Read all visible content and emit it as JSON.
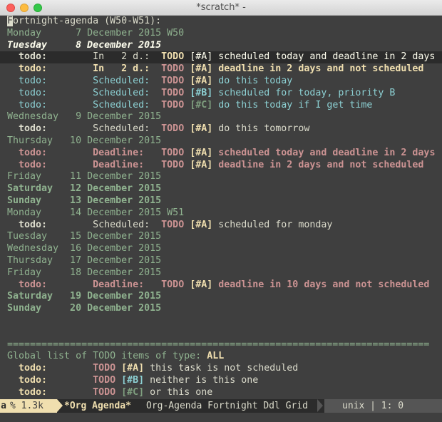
{
  "window": {
    "title": "*scratch* -"
  },
  "agenda": {
    "header": "Fortnight-agenda (W50-W51):",
    "lines": [
      "Monday      7 December 2015 W50",
      "Tuesday     8 December 2015",
      "  todo:        In   2 d.:  TODO [#A] scheduled today and deadline in 2 days",
      "  todo:        In   2 d.:  TODO [#A] deadline in 2 days and not scheduled",
      "  todo:        Scheduled:  TODO [#A] do this today",
      "  todo:        Scheduled:  TODO [#B] scheduled for today, priority B",
      "  todo:        Scheduled:  TODO [#C] do this today if I get time",
      "Wednesday   9 December 2015",
      "  todo:        Scheduled:  TODO [#A] do this tomorrow",
      "Thursday   10 December 2015",
      "  todo:        Deadline:   TODO [#A] scheduled today and deadline in 2 days",
      "  todo:        Deadline:   TODO [#A] deadline in 2 days and not scheduled",
      "Friday     11 December 2015",
      "Saturday   12 December 2015",
      "Sunday     13 December 2015",
      "Monday     14 December 2015 W51",
      "  todo:        Scheduled:  TODO [#A] scheduled for monday",
      "Tuesday    15 December 2015",
      "Wednesday  16 December 2015",
      "Thursday   17 December 2015",
      "Friday     18 December 2015",
      "  todo:        Deadline:   TODO [#A] deadline in 10 days and not scheduled",
      "Saturday   19 December 2015",
      "Sunday     20 December 2015"
    ]
  },
  "global": {
    "separator": "==========================================================================",
    "header_prefix": "Global list of TODO items of type: ",
    "header_type": "ALL",
    "lines": [
      "  todo:        TODO [#A] this task is not scheduled",
      "  todo:        TODO [#B] neither is this one",
      "  todo:        TODO [#C] or this one"
    ]
  },
  "modeline": {
    "indicator": "a",
    "size": "% 1.3k",
    "buffer_name": "*Org Agenda*",
    "modes": "Org-Agenda Fortnight Ddl Grid",
    "encoding": "unix | 1: 0"
  },
  "colors": {
    "background": "#3f3f3f",
    "foreground": "#dcdccc",
    "day_green": "#8fb28f",
    "todo_yellow": "#f0dfaf",
    "scheduled_blue": "#8cd0d3",
    "deadline_red": "#cc9393",
    "priority_c_green": "#7f9f7f",
    "modeline_bg": "#2b2b2b"
  }
}
